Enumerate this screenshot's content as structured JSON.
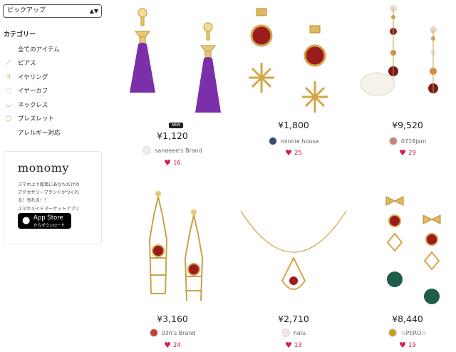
{
  "sort": {
    "selected": "ピックアップ"
  },
  "categories": {
    "title": "カテゴリー",
    "items": [
      {
        "label": "全てのアイテム",
        "icon": "none"
      },
      {
        "label": "ピアス",
        "icon": "pierce-icon"
      },
      {
        "label": "イヤリング",
        "icon": "earring-icon"
      },
      {
        "label": "イヤーカフ",
        "icon": "earcuff-icon"
      },
      {
        "label": "ネックレス",
        "icon": "necklace-icon"
      },
      {
        "label": "ブレスレット",
        "icon": "bracelet-icon"
      },
      {
        "label": "アレルギー対応",
        "icon": "none"
      }
    ]
  },
  "promo": {
    "logo": "monomy",
    "desc_lines": [
      "スマホ上で簡単にあなただけの",
      "アクセサリーブランドがつくれ",
      "る！売れる！！",
      "スマホメイドマーケットアプリ"
    ],
    "app_store_line1": "App Store",
    "app_store_line2": "からダウンロード"
  },
  "products": [
    {
      "badge": "NEW",
      "price": "¥1,120",
      "shop": "sanaeee's Brand",
      "likes": "16",
      "avatar_color": "#e8efe6"
    },
    {
      "badge": "",
      "price": "¥1,800",
      "shop": "minnie house",
      "likes": "25",
      "avatar_color": "#3a4a6a"
    },
    {
      "badge": "",
      "price": "¥9,520",
      "shop": "0718jam",
      "likes": "29",
      "avatar_color": "#c9857a"
    },
    {
      "badge": "",
      "price": "¥3,160",
      "shop": "03n's Brand",
      "likes": "24",
      "avatar_color": "#c8402f"
    },
    {
      "badge": "",
      "price": "¥2,710",
      "shop": "halu",
      "likes": "13",
      "avatar_color": "#f3e4e4"
    },
    {
      "badge": "",
      "price": "¥8,440",
      "shop": "☆PERO☆",
      "likes": "19",
      "avatar_color": "#c8a020"
    }
  ],
  "colors": {
    "heart": "#d81b60",
    "gold": "#c9a24a",
    "garnet": "#9b1c1c",
    "purple": "#7b2fa8",
    "green": "#1f5c4a"
  }
}
